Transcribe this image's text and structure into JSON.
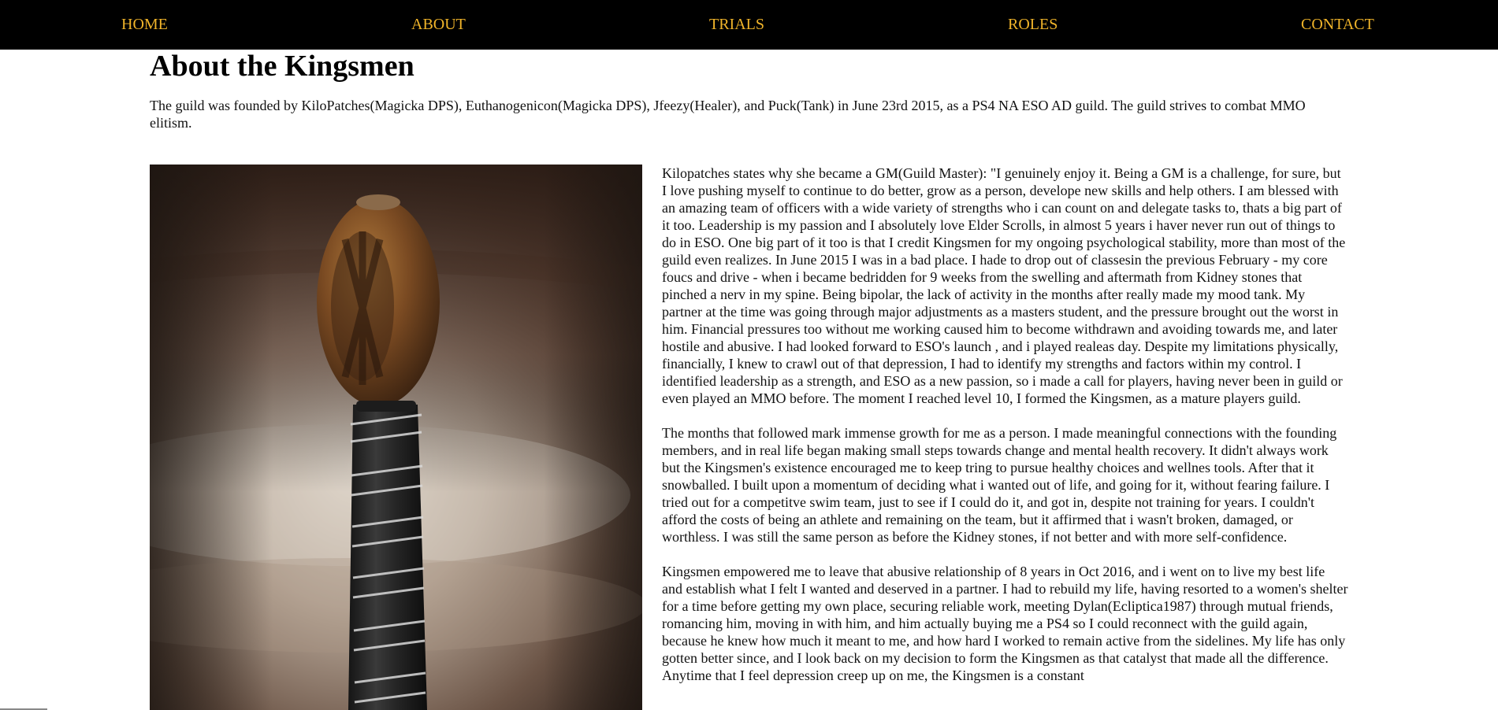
{
  "nav": {
    "home": "HOME",
    "about": "ABOUT",
    "trials": "TRIALS",
    "roles": "ROLES",
    "contact": "CONTACT"
  },
  "page": {
    "title": "About the Kingsmen",
    "intro": "The guild was founded by KiloPatches(Magicka DPS), Euthanogenicon(Magicka DPS), Jfeezy(Healer), and Puck(Tank) in June 23rd 2015, as a PS4 NA ESO AD guild. The guild strives to combat MMO elitism."
  },
  "story": {
    "p1": "Kilopatches states why she became a GM(Guild Master): \"I genuinely enjoy it. Being a GM is a challenge, for sure, but I love pushing myself to continue to do better, grow as a person, develope new skills and help others. I am blessed with an amazing team of officers with a wide variety of strengths who i can count on and delegate tasks to, thats a big part of it too. Leadership is my passion and I absolutely love Elder Scrolls, in almost 5 years i haver never run out of things to do in ESO. One big part of it too is that I credit Kingsmen for my ongoing psychological stability, more than most of the guild even realizes. In June 2015 I was in a bad place. I hade to drop out of classesin the previous February - my core foucs and drive - when i became bedridden for 9 weeks from the swelling and aftermath from Kidney stones that pinched a nerv in my spine. Being bipolar, the lack of activity in the months after really made my mood tank. My partner at the time was going through major adjustments as a masters student, and the pressure brought out the worst in him. Financial pressures too without me working caused him to become withdrawn and avoiding towards me, and later hostile and abusive. I had looked forward to ESO's launch , and i played realeas day. Despite my limitations physically, financially, I knew to crawl out of that depression, I had to identify my strengths and factors within my control. I identified leadership as a strength, and ESO as a new passion, so i made a call for players, having never been in guild or even played an MMO before. The moment I reached level 10, I formed the Kingsmen, as a mature players guild.",
    "p2": "The months that followed mark immense growth for me as a person. I made meaningful connections with the founding members, and in real life began making small steps towards change and mental health recovery. It didn't always work but the Kingsmen's existence encouraged me to keep tring to pursue healthy choices and wellnes tools. After that it snowballed. I built upon a momentum of deciding what i wanted out of life, and going for it, without fearing failure. I tried out for a competitve swim team, just to see if I could do it, and got in, despite not training for years. I couldn't afford the costs of being an athlete and remaining on the team, but it affirmed that i wasn't broken, damaged, or worthless. I was still the same person as before the Kidney stones, if not better and with more self-confidence.",
    "p3": "Kingsmen empowered me to leave that abusive relationship of 8 years in Oct 2016, and i went on to live my best life and establish what I felt I wanted and deserved in a partner. I had to rebuild my life, having resorted to a women's shelter for a time before getting my own place, securing reliable work, meeting Dylan(Ecliptica1987) through mutual friends, romancing him, moving in with him, and him actually buying me a PS4 so I could reconnect with the guild again, because he knew how much it meant to me, and how hard I worked to remain active from the sidelines. My life has only gotten better since, and I look back on my decision to form the Kingsmen as that catalyst that made all the difference. Anytime that I feel depression creep up on me, the Kingsmen is a constant"
  },
  "colors": {
    "nav_background": "#000000",
    "nav_link": "#f0b42a",
    "text": "#111111"
  }
}
